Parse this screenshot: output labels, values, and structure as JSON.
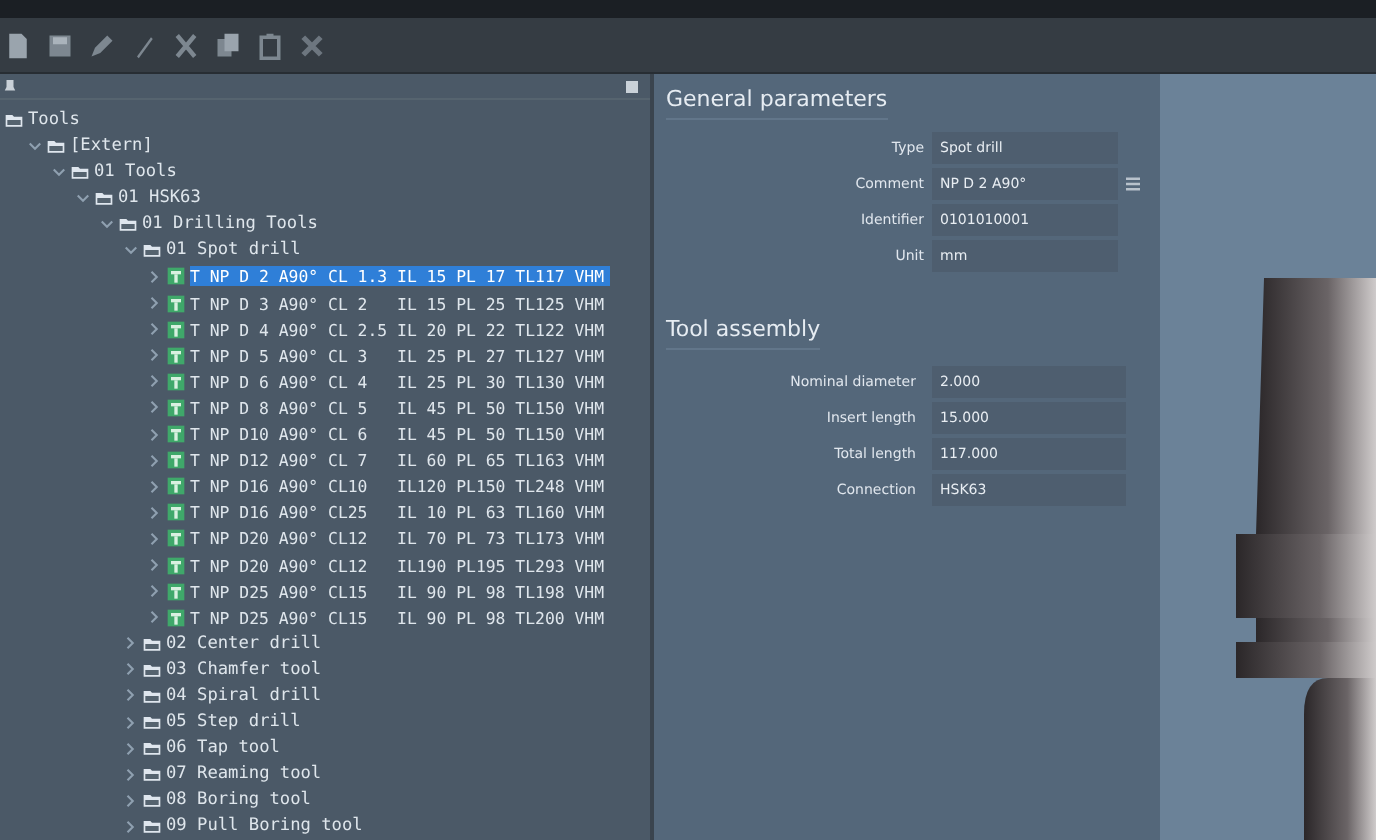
{
  "toolbar": {
    "buttons": [
      {
        "kind": "new"
      },
      {
        "kind": "save"
      },
      {
        "kind": "edit"
      },
      {
        "kind": "wand"
      },
      {
        "kind": "cut"
      },
      {
        "kind": "copy"
      },
      {
        "kind": "paste"
      },
      {
        "kind": "delete"
      }
    ]
  },
  "tree": {
    "label": "Tools",
    "selected": false,
    "kind": "root",
    "children": [
      {
        "label": "[Extern]",
        "selected": false,
        "expanded": true,
        "kind": "folder",
        "children": [
          {
            "label": "01 Tools",
            "selected": false,
            "expanded": true,
            "kind": "folder",
            "children": [
              {
                "label": "01 HSK63",
                "selected": false,
                "expanded": true,
                "kind": "folder",
                "children": [
                  {
                    "label": "01 Drilling Tools",
                    "selected": false,
                    "expanded": true,
                    "kind": "folder",
                    "children": [
                      {
                        "label": "01 Spot drill",
                        "selected": false,
                        "expanded": true,
                        "kind": "folder",
                        "children": [
                          {
                            "label": "T NP D 2 A90° CL 1.3 IL 15 PL 17 TL117 VHM",
                            "selected": true,
                            "expanded": false,
                            "kind": "tool"
                          },
                          {
                            "label": "T NP D 3 A90° CL 2   IL 15 PL 25 TL125 VHM",
                            "selected": false,
                            "expanded": false,
                            "kind": "tool"
                          },
                          {
                            "label": "T NP D 4 A90° CL 2.5 IL 20 PL 22 TL122 VHM",
                            "selected": false,
                            "expanded": false,
                            "kind": "tool"
                          },
                          {
                            "label": "T NP D 5 A90° CL 3   IL 25 PL 27 TL127 VHM",
                            "selected": false,
                            "expanded": false,
                            "kind": "tool"
                          },
                          {
                            "label": "T NP D 6 A90° CL 4   IL 25 PL 30 TL130 VHM",
                            "selected": false,
                            "expanded": false,
                            "kind": "tool"
                          },
                          {
                            "label": "T NP D 8 A90° CL 5   IL 45 PL 50 TL150 VHM",
                            "selected": false,
                            "expanded": false,
                            "kind": "tool"
                          },
                          {
                            "label": "T NP D10 A90° CL 6   IL 45 PL 50 TL150 VHM",
                            "selected": false,
                            "expanded": false,
                            "kind": "tool"
                          },
                          {
                            "label": "T NP D12 A90° CL 7   IL 60 PL 65 TL163 VHM",
                            "selected": false,
                            "expanded": false,
                            "kind": "tool"
                          },
                          {
                            "label": "T NP D16 A90° CL10   IL120 PL150 TL248 VHM",
                            "selected": false,
                            "expanded": false,
                            "kind": "tool"
                          },
                          {
                            "label": "T NP D16 A90° CL25   IL 10 PL 63 TL160 VHM",
                            "selected": false,
                            "expanded": false,
                            "kind": "tool"
                          },
                          {
                            "label": "T NP D20 A90° CL12   IL 70 PL 73 TL173 VHM",
                            "selected": false,
                            "expanded": false,
                            "kind": "tool"
                          },
                          {
                            "label": "T NP D20 A90° CL12   IL190 PL195 TL293 VHM",
                            "selected": false,
                            "expanded": false,
                            "kind": "tool"
                          },
                          {
                            "label": "T NP D25 A90° CL15   IL 90 PL 98 TL198 VHM",
                            "selected": false,
                            "expanded": false,
                            "kind": "tool"
                          },
                          {
                            "label": "T NP D25 A90° CL15   IL 90 PL 98 TL200 VHM",
                            "selected": false,
                            "expanded": false,
                            "kind": "tool"
                          }
                        ]
                      },
                      {
                        "label": "02 Center drill",
                        "selected": false,
                        "expanded": false,
                        "kind": "folder"
                      },
                      {
                        "label": "03 Chamfer tool",
                        "selected": false,
                        "expanded": false,
                        "kind": "folder"
                      },
                      {
                        "label": "04 Spiral drill",
                        "selected": false,
                        "expanded": false,
                        "kind": "folder"
                      },
                      {
                        "label": "05 Step drill",
                        "selected": false,
                        "expanded": false,
                        "kind": "folder"
                      },
                      {
                        "label": "06 Tap tool",
                        "selected": false,
                        "expanded": false,
                        "kind": "folder"
                      },
                      {
                        "label": "07 Reaming tool",
                        "selected": false,
                        "expanded": false,
                        "kind": "folder"
                      },
                      {
                        "label": "08 Boring tool",
                        "selected": false,
                        "expanded": false,
                        "kind": "folder"
                      },
                      {
                        "label": "09 Pull Boring tool",
                        "selected": false,
                        "expanded": false,
                        "kind": "folder"
                      }
                    ]
                  }
                ]
              }
            ]
          }
        ]
      }
    ]
  },
  "general_parameters": {
    "title": "General parameters",
    "fields": [
      {
        "label": "Type",
        "value": "Spot drill",
        "kind": "text"
      },
      {
        "label": "Comment",
        "value": "NP D 2 A90°",
        "kind": "editable"
      },
      {
        "label": "Identifier",
        "value": "0101010001",
        "kind": "text"
      },
      {
        "label": "Unit",
        "value": "mm",
        "kind": "text"
      }
    ]
  },
  "tool_assembly": {
    "title": "Tool assembly",
    "fields": [
      {
        "label": "Nominal diameter",
        "value": "2.000"
      },
      {
        "label": "Insert length",
        "value": "15.000"
      },
      {
        "label": "Total length",
        "value": "117.000"
      },
      {
        "label": "Connection",
        "value": "HSK63"
      }
    ]
  }
}
